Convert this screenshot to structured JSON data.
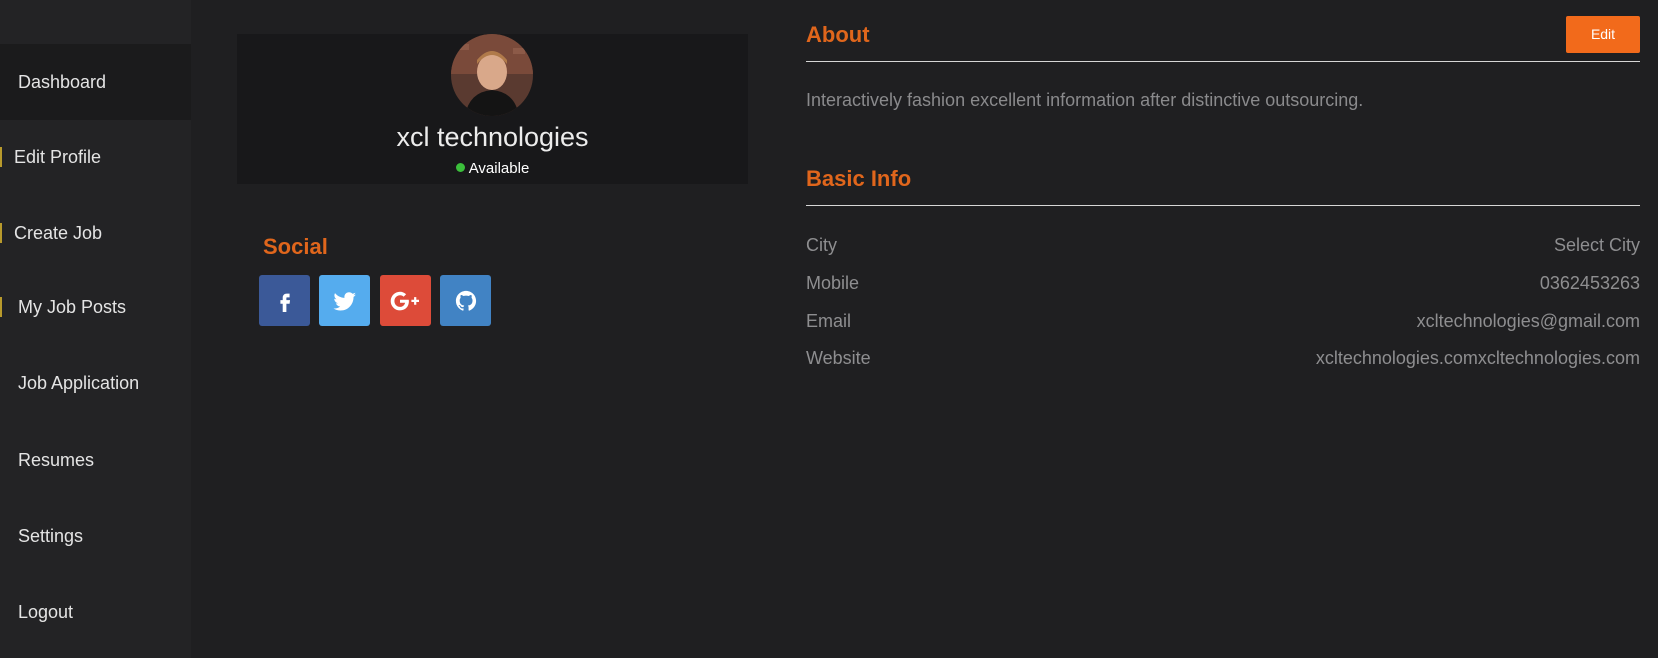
{
  "sidebar": {
    "items": [
      {
        "label": "Dashboard"
      },
      {
        "label": "Edit Profile"
      },
      {
        "label": "Create Job"
      },
      {
        "label": "My Job Posts"
      },
      {
        "label": "Job Application"
      },
      {
        "label": "Resumes"
      },
      {
        "label": "Settings"
      },
      {
        "label": "Logout"
      }
    ]
  },
  "profile": {
    "name": "xcl technologies",
    "status": "Available"
  },
  "social": {
    "title": "Social",
    "buttons": [
      {
        "icon": "facebook-icon",
        "color": "#3b5998"
      },
      {
        "icon": "twitter-icon",
        "color": "#55acee"
      },
      {
        "icon": "google-plus-icon",
        "color": "#dd4b39"
      },
      {
        "icon": "github-icon",
        "color": "#4183c4"
      }
    ]
  },
  "about": {
    "title": "About",
    "edit_label": "Edit",
    "text": "Interactively fashion excellent information after distinctive outsourcing."
  },
  "basic_info": {
    "title": "Basic Info",
    "rows": [
      {
        "label": "City",
        "value": "Select City"
      },
      {
        "label": "Mobile",
        "value": "0362453263"
      },
      {
        "label": "Email",
        "value": "xcltechnologies@gmail.com"
      },
      {
        "label": "Website",
        "value": "xcltechnologies.comxcltechnologies.com"
      }
    ]
  },
  "colors": {
    "accent": "#e0661c",
    "button": "#f26a1b",
    "background": "#1f1f21",
    "sidebar": "#232325",
    "status_online": "#3bbf3b"
  }
}
